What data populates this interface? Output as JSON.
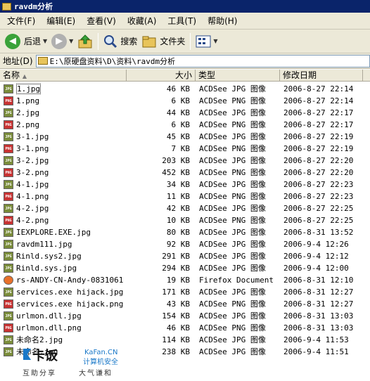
{
  "window": {
    "title": "ravdm分析"
  },
  "menu": [
    "文件(F)",
    "编辑(E)",
    "查看(V)",
    "收藏(A)",
    "工具(T)",
    "帮助(H)"
  ],
  "toolbar": {
    "back": "后退",
    "search": "搜索",
    "folders": "文件夹"
  },
  "address": {
    "label": "地址(D)",
    "value": "E:\\原硬盘资料\\D\\资料\\ravdm分析"
  },
  "columns": {
    "name": "名称",
    "size": "大小",
    "type": "类型",
    "modified": "修改日期"
  },
  "files": [
    {
      "name": "1.jpg",
      "size": "46 KB",
      "type": "ACDSee JPG 图像",
      "modified": "2006-8-27 22:14",
      "icon": "jpg"
    },
    {
      "name": "1.png",
      "size": "6 KB",
      "type": "ACDSee PNG 图像",
      "modified": "2006-8-27 22:14",
      "icon": "png"
    },
    {
      "name": "2.jpg",
      "size": "44 KB",
      "type": "ACDSee JPG 图像",
      "modified": "2006-8-27 22:17",
      "icon": "jpg"
    },
    {
      "name": "2.png",
      "size": "6 KB",
      "type": "ACDSee PNG 图像",
      "modified": "2006-8-27 22:17",
      "icon": "png"
    },
    {
      "name": "3-1.jpg",
      "size": "45 KB",
      "type": "ACDSee JPG 图像",
      "modified": "2006-8-27 22:19",
      "icon": "jpg"
    },
    {
      "name": "3-1.png",
      "size": "7 KB",
      "type": "ACDSee PNG 图像",
      "modified": "2006-8-27 22:19",
      "icon": "png"
    },
    {
      "name": "3-2.jpg",
      "size": "203 KB",
      "type": "ACDSee JPG 图像",
      "modified": "2006-8-27 22:20",
      "icon": "jpg"
    },
    {
      "name": "3-2.png",
      "size": "452 KB",
      "type": "ACDSee PNG 图像",
      "modified": "2006-8-27 22:20",
      "icon": "png"
    },
    {
      "name": "4-1.jpg",
      "size": "34 KB",
      "type": "ACDSee JPG 图像",
      "modified": "2006-8-27 22:23",
      "icon": "jpg"
    },
    {
      "name": "4-1.png",
      "size": "11 KB",
      "type": "ACDSee PNG 图像",
      "modified": "2006-8-27 22:23",
      "icon": "png"
    },
    {
      "name": "4-2.jpg",
      "size": "42 KB",
      "type": "ACDSee JPG 图像",
      "modified": "2006-8-27 22:25",
      "icon": "jpg"
    },
    {
      "name": "4-2.png",
      "size": "10 KB",
      "type": "ACDSee PNG 图像",
      "modified": "2006-8-27 22:25",
      "icon": "png"
    },
    {
      "name": "IEXPLORE.EXE.jpg",
      "size": "80 KB",
      "type": "ACDSee JPG 图像",
      "modified": "2006-8-31 13:52",
      "icon": "jpg"
    },
    {
      "name": "ravdm111.jpg",
      "size": "92 KB",
      "type": "ACDSee JPG 图像",
      "modified": "2006-9-4 12:26",
      "icon": "jpg"
    },
    {
      "name": "Rinld.sys2.jpg",
      "size": "291 KB",
      "type": "ACDSee JPG 图像",
      "modified": "2006-9-4 12:12",
      "icon": "jpg"
    },
    {
      "name": "Rinld.sys.jpg",
      "size": "294 KB",
      "type": "ACDSee JPG 图像",
      "modified": "2006-9-4 12:00",
      "icon": "jpg"
    },
    {
      "name": "rs-ANDY-CN-Andy-0831061...",
      "size": "19 KB",
      "type": "Firefox Document",
      "modified": "2006-8-31 12:10",
      "icon": "ff"
    },
    {
      "name": "services.exe hijack.jpg",
      "size": "171 KB",
      "type": "ACDSee JPG 图像",
      "modified": "2006-8-31 12:27",
      "icon": "jpg"
    },
    {
      "name": "services.exe hijack.png",
      "size": "43 KB",
      "type": "ACDSee PNG 图像",
      "modified": "2006-8-31 12:27",
      "icon": "png"
    },
    {
      "name": "urlmon.dll.jpg",
      "size": "154 KB",
      "type": "ACDSee JPG 图像",
      "modified": "2006-8-31 13:03",
      "icon": "jpg"
    },
    {
      "name": "urlmon.dll.png",
      "size": "46 KB",
      "type": "ACDSee PNG 图像",
      "modified": "2006-8-31 13:03",
      "icon": "png"
    },
    {
      "name": "未命名2.jpg",
      "size": "114 KB",
      "type": "ACDSee JPG 图像",
      "modified": "2006-9-4 11:53",
      "icon": "jpg"
    },
    {
      "name": "未命名.jpg",
      "size": "238 KB",
      "type": "ACDSee JPG 图像",
      "modified": "2006-9-4 11:51",
      "icon": "jpg"
    }
  ],
  "watermark": {
    "brand": "卡饭",
    "site": "KaFan.CN",
    "tagline_cn": "计算机安全",
    "slogan_left": "互助分享",
    "slogan_right": "大气谦和"
  },
  "colors": {
    "titlebar": "#0a246a",
    "chrome": "#ece9d8",
    "back_green": "#3aa23a",
    "jpg_icon": "#7a8c3a",
    "png_icon": "#c83232"
  }
}
